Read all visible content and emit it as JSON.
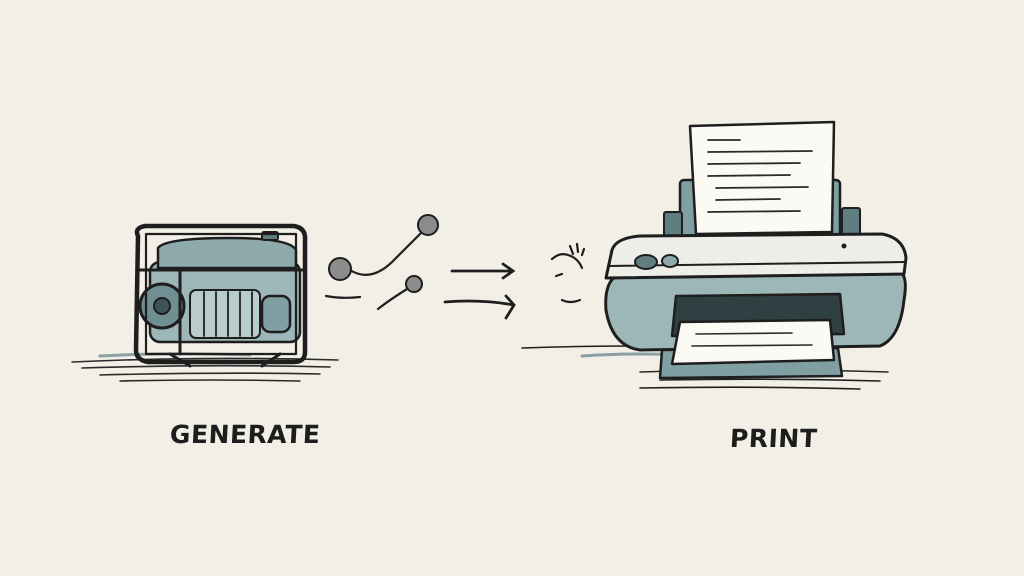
{
  "labels": {
    "generate": "GENERATE",
    "print": "PRINT"
  },
  "icons": {
    "generator": "generator-icon",
    "flow": "arrow-icon",
    "printer": "printer-icon"
  },
  "colors": {
    "background": "#f2efe6",
    "ink": "#1e1e1e",
    "teal_light": "#a6bfc1",
    "teal_mid": "#7f9fa2",
    "teal_dark": "#5f7e82",
    "paper": "#fbfaf4"
  }
}
